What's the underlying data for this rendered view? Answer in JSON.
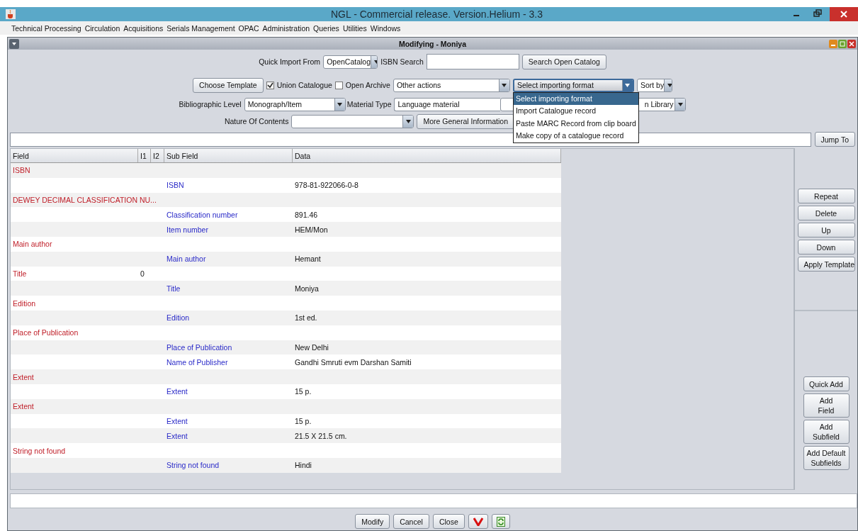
{
  "window": {
    "title": "NGL - Commercial release. Version.Helium - 3.3"
  },
  "menu": [
    "Technical Processing",
    "Circulation",
    "Acquisitions",
    "Serials Management",
    "OPAC",
    "Administration",
    "Queries",
    "Utilities",
    "Windows"
  ],
  "frame": {
    "title": "Modifying - Moniya"
  },
  "quick_import": {
    "label": "Quick Import From",
    "value": "OpenCatalog",
    "isbn_label": "ISBN Search",
    "search_button": "Search Open Catalog"
  },
  "toolbar": {
    "choose_template": "Choose Template",
    "union_catalogue": {
      "label": "Union Catalogue",
      "checked": true
    },
    "open_archive": {
      "label": "Open Archive",
      "checked": false
    },
    "other_actions": "Other actions",
    "import_format": "Select importing format",
    "sort_by": "Sort by"
  },
  "import_menu": [
    {
      "label": "Select importing format",
      "selected": true
    },
    {
      "label": "Import Catalogue record",
      "selected": false
    },
    {
      "label": "Paste MARC Record from clip board",
      "selected": false
    },
    {
      "label": "Make copy of a catalogue record",
      "selected": false
    }
  ],
  "bibliographic": {
    "level_label": "Bibliographic Level",
    "level_value": "Monograph/Item",
    "material_label": "Material Type",
    "material_value": "Language material",
    "library_value": "n Library"
  },
  "nature": {
    "label": "Nature Of Contents",
    "more_button": "More General Information"
  },
  "jump_button": "Jump To",
  "table": {
    "columns": [
      "Field",
      "I1",
      "I2",
      "Sub Field",
      "Data"
    ],
    "rows": [
      {
        "kind": "field",
        "field": "ISBN"
      },
      {
        "kind": "subfield",
        "subfield": "ISBN",
        "data": "978-81-922066-0-8"
      },
      {
        "kind": "field",
        "field": "DEWEY DECIMAL CLASSIFICATION NU..."
      },
      {
        "kind": "subfield",
        "subfield": "Classification number",
        "data": "891.46"
      },
      {
        "kind": "subfield",
        "subfield": "Item number",
        "data": "HEM/Mon"
      },
      {
        "kind": "field",
        "field": "Main author"
      },
      {
        "kind": "subfield",
        "subfield": "Main author",
        "data": "Hemant"
      },
      {
        "kind": "field",
        "field": "Title",
        "i1": "0"
      },
      {
        "kind": "subfield",
        "subfield": "Title",
        "data": "Moniya"
      },
      {
        "kind": "field",
        "field": "Edition"
      },
      {
        "kind": "subfield",
        "subfield": "Edition",
        "data": "1st ed."
      },
      {
        "kind": "field",
        "field": "Place of Publication"
      },
      {
        "kind": "subfield",
        "subfield": "Place of Publication",
        "data": "New Delhi"
      },
      {
        "kind": "subfield",
        "subfield": "Name of Publisher",
        "data": "Gandhi Smruti evm Darshan Samiti"
      },
      {
        "kind": "field",
        "field": "Extent"
      },
      {
        "kind": "subfield",
        "subfield": "Extent",
        "data": "15 p."
      },
      {
        "kind": "field",
        "field": "Extent"
      },
      {
        "kind": "subfield",
        "subfield": "Extent",
        "data": "15 p."
      },
      {
        "kind": "subfield",
        "subfield": "Extent",
        "data": "21.5 X 21.5 cm."
      },
      {
        "kind": "field",
        "field": "String not found"
      },
      {
        "kind": "subfield",
        "subfield": "String not found",
        "data": "Hindi"
      }
    ]
  },
  "side_buttons_top": [
    "Repeat",
    "Delete",
    "Up",
    "Down",
    "Apply Template"
  ],
  "side_buttons_bottom": [
    "Quick Add",
    "Add\nField",
    "Add\nSubfield",
    "Add Default\nSubfields"
  ],
  "bottom_buttons": [
    "Modify",
    "Cancel",
    "Close"
  ]
}
